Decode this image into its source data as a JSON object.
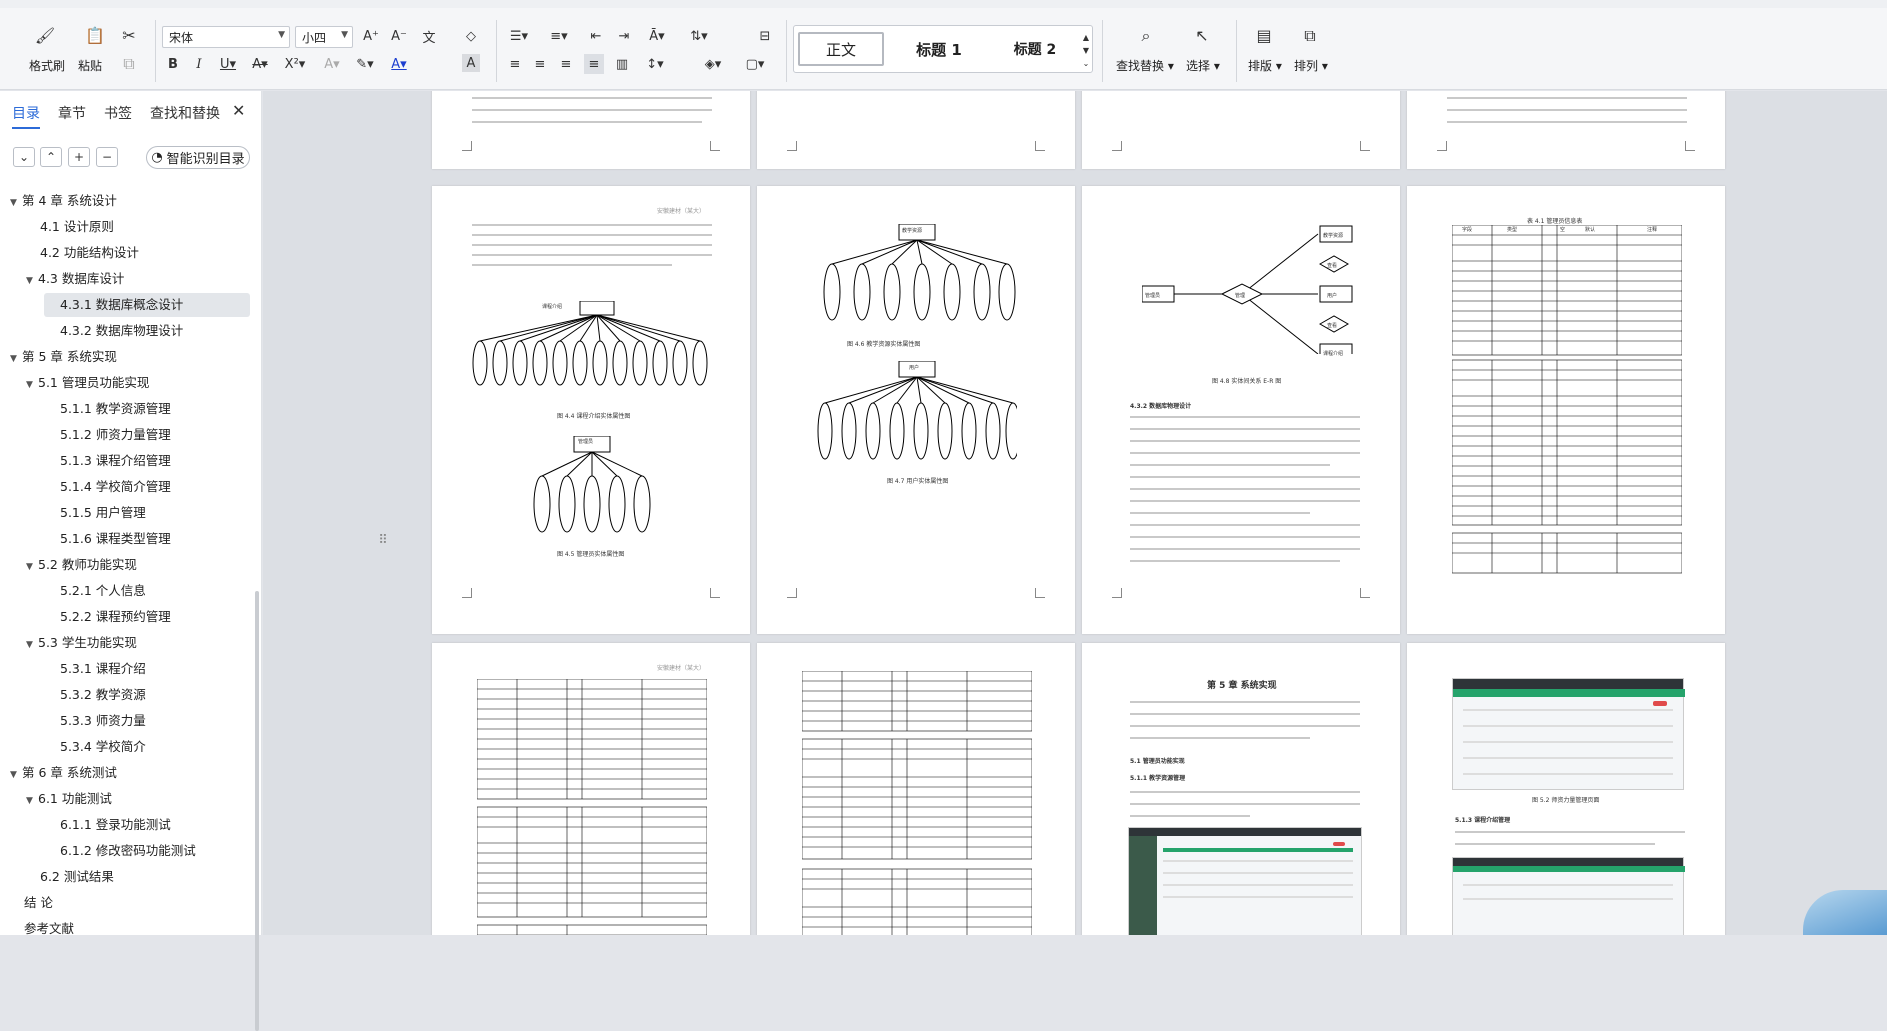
{
  "ribbon": {
    "format_brush": "格式刷",
    "paste": "粘贴",
    "font_family": "宋体",
    "font_size": "小四",
    "styles": [
      "正文",
      "标题 1",
      "标题 2"
    ],
    "find_replace": "查找替换",
    "select": "选择",
    "layout": "排版",
    "arrange": "排列"
  },
  "nav": {
    "tabs": [
      "目录",
      "章节",
      "书签",
      "查找和替换"
    ],
    "smart_button": "智能识别目录",
    "toc": [
      {
        "label": "第 4 章  系统设计",
        "level": 0,
        "expand": true
      },
      {
        "label": "4.1  设计原则",
        "level": 1
      },
      {
        "label": "4.2  功能结构设计",
        "level": 1
      },
      {
        "label": "4.3  数据库设计",
        "level": 1,
        "expand": true
      },
      {
        "label": "4.3.1  数据库概念设计",
        "level": 2,
        "selected": true
      },
      {
        "label": "4.3.2  数据库物理设计",
        "level": 2
      },
      {
        "label": "第 5 章  系统实现",
        "level": 0,
        "expand": true
      },
      {
        "label": "5.1  管理员功能实现",
        "level": 1,
        "expand": true
      },
      {
        "label": "5.1.1  教学资源管理",
        "level": 2
      },
      {
        "label": "5.1.2  师资力量管理",
        "level": 2
      },
      {
        "label": "5.1.3  课程介绍管理",
        "level": 2
      },
      {
        "label": "5.1.4  学校简介管理",
        "level": 2
      },
      {
        "label": "5.1.5  用户管理",
        "level": 2
      },
      {
        "label": "5.1.6  课程类型管理",
        "level": 2
      },
      {
        "label": "5.2  教师功能实现",
        "level": 1,
        "expand": true
      },
      {
        "label": "5.2.1  个人信息",
        "level": 2
      },
      {
        "label": "5.2.2  课程预约管理",
        "level": 2
      },
      {
        "label": "5.3  学生功能实现",
        "level": 1,
        "expand": true
      },
      {
        "label": "5.3.1  课程介绍",
        "level": 2
      },
      {
        "label": "5.3.2  教学资源",
        "level": 2
      },
      {
        "label": "5.3.3  师资力量",
        "level": 2
      },
      {
        "label": "5.3.4  学校简介",
        "level": 2
      },
      {
        "label": "第 6 章  系统测试",
        "level": 0,
        "expand": true
      },
      {
        "label": "6.1  功能测试",
        "level": 1,
        "expand": true
      },
      {
        "label": "6.1.1  登录功能测试",
        "level": 2
      },
      {
        "label": "6.1.2  修改密码功能测试",
        "level": 2
      },
      {
        "label": "6.2  测试结果",
        "level": 1
      },
      {
        "label": "结    论",
        "level": 0
      },
      {
        "label": "参考文献",
        "level": 0
      }
    ]
  },
  "document": {
    "header_text": "安徽建材（某大）",
    "captions": {
      "p2_fig1": "图 4.6 教学资源实体属性图",
      "p2_fig2": "图 4.7 用户实体属性图",
      "p3_fig": "图 4.8 实体间关系 E-R 图",
      "p3_heading": "4.3.2 数据库物理设计",
      "p1_fig1": "图 4.4 课程介绍实体属性图",
      "p1_fig2": "图 4.5 管理员实体属性图",
      "p4_table": "表 4.1 管理员信息表",
      "ch5_title": "第 5 章  系统实现",
      "ch5_h1": "5.1  管理员功能实现",
      "ch5_h2": "5.1.1  教学资源管理",
      "p8_fig": "图 5.2 师资力量管理页面",
      "p8_h": "5.1.3  课程介绍管理"
    },
    "er_labels": [
      "管理员",
      "管理",
      "教学资源",
      "查看",
      "用户",
      "查看",
      "课程介绍"
    ],
    "entity_labels": [
      "课程介绍",
      "教学资源",
      "用户",
      "管理员"
    ],
    "table_headers": [
      "字段",
      "类型",
      "空",
      "默认",
      "注释"
    ]
  },
  "colors": {
    "accent": "#2c6bd8",
    "selected_bg": "#e3e6ea",
    "canvas": "#dcdfe4"
  }
}
